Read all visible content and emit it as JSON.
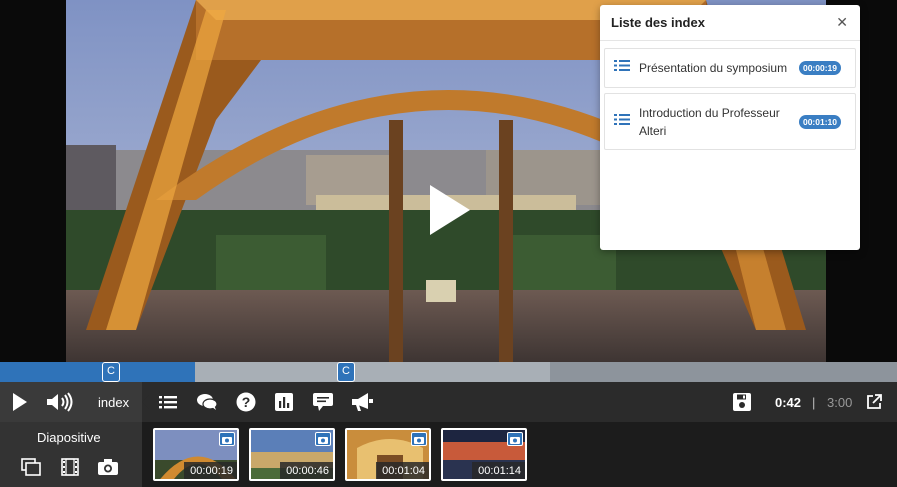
{
  "index_panel": {
    "title": "Liste des index",
    "close_icon": "close-icon",
    "items": [
      {
        "label": "Présentation du symposium",
        "time": "00:00:19"
      },
      {
        "label_line1": "Introduction du Professeur",
        "label_line2": "Alteri",
        "time": "00:01:10"
      }
    ]
  },
  "timeline": {
    "played_fraction": 0.217,
    "markers": [
      {
        "label": "C",
        "time": "00:00:19"
      },
      {
        "label": "C",
        "time": "00:00:46"
      }
    ]
  },
  "controls": {
    "index_label": "index",
    "current_time": "0:42",
    "separator": "|",
    "total_time": "3:00",
    "icons": [
      "play-icon",
      "volume-icon",
      "list-icon",
      "chat-icon",
      "help-icon",
      "chart-icon",
      "comment-icon",
      "megaphone-icon",
      "save-icon",
      "external-link-icon"
    ]
  },
  "slides": {
    "label": "Diapositive",
    "mode_icons": [
      "slides-overlay-icon",
      "film-icon",
      "camera-icon"
    ],
    "thumbs": [
      {
        "time": "00:00:19"
      },
      {
        "time": "00:00:46"
      },
      {
        "time": "00:01:04"
      },
      {
        "time": "00:01:14"
      }
    ]
  },
  "colors": {
    "accent": "#2f73b9",
    "bar": "#2b2b2b",
    "strip": "#1c1c1c"
  }
}
